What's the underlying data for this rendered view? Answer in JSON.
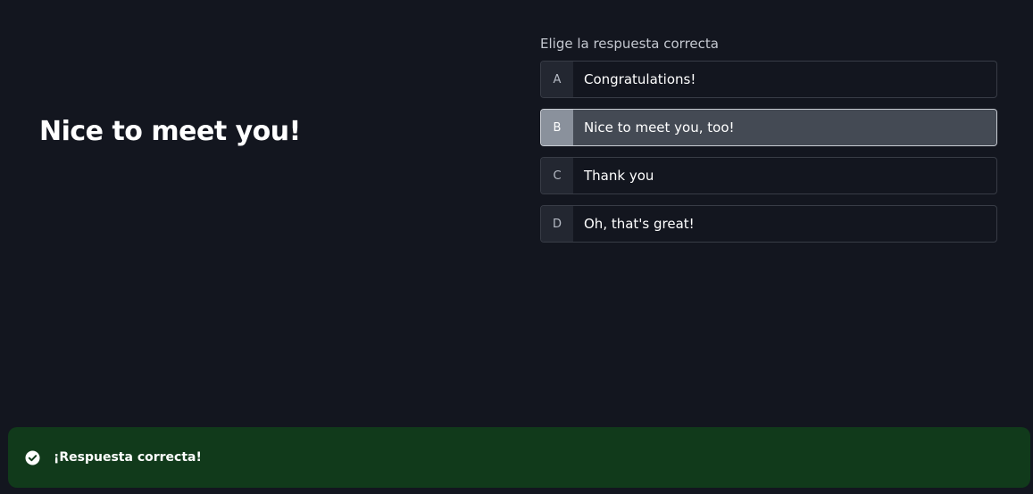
{
  "question": {
    "prompt": "Nice to meet you!",
    "instruction": "Elige la respuesta correcta"
  },
  "options": [
    {
      "letter": "A",
      "text": "Congratulations!",
      "selected": false
    },
    {
      "letter": "B",
      "text": "Nice to meet you, too!",
      "selected": true
    },
    {
      "letter": "C",
      "text": "Thank you",
      "selected": false
    },
    {
      "letter": "D",
      "text": "Oh, that's great!",
      "selected": false
    }
  ],
  "feedback": {
    "icon": "check-circle-icon",
    "message": "¡Respuesta correcta!",
    "color": "#113a1b"
  },
  "colors": {
    "background": "#13161f",
    "selected_option": "#444a54"
  }
}
